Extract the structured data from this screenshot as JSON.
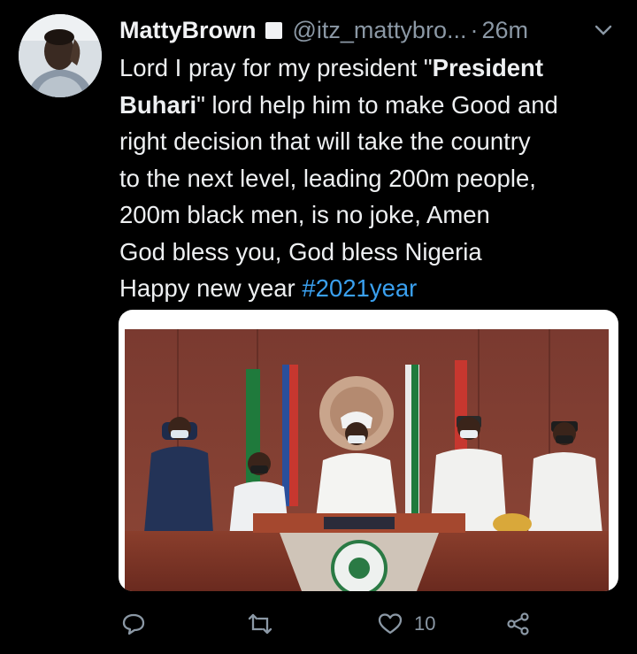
{
  "tweet": {
    "author_name": "MattyBrown",
    "author_handle": "@itz_mattybro...",
    "separator": "·",
    "time": "26m",
    "text_line1_pre": "Lord I pray for my president \"",
    "text_line1_bold": "President",
    "text_line2_bold": "Buhari",
    "text_line2_post": "\" lord help him to make Good and",
    "text_line3": "right decision that will take the country",
    "text_line4": "to the next level, leading 200m people,",
    "text_line5": "200m black men, is no joke, Amen",
    "text_line6": "God bless you, God bless Nigeria",
    "text_line7_pre": "Happy new year ",
    "hashtag": "#2021year"
  },
  "actions": {
    "like_count": "10"
  },
  "icons": {
    "reply": "reply-icon",
    "retweet": "retweet-icon",
    "like": "heart-icon",
    "share": "share-icon",
    "more": "chevron-down-icon",
    "verified": "verified-badge-icon"
  },
  "colors": {
    "background": "#000000",
    "text": "#eef0f2",
    "muted": "#8b98a5",
    "link": "#3aa0ef"
  }
}
